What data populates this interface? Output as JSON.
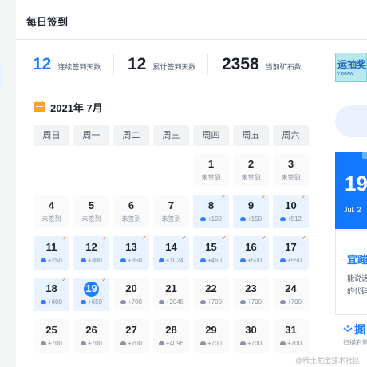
{
  "header": {
    "title": "每日签到"
  },
  "stats": [
    {
      "value": "12",
      "label": "连续签到天数",
      "color": "#1e80ff"
    },
    {
      "value": "12",
      "label": "累计签到天数",
      "color": "#1d2129"
    },
    {
      "value": "2358",
      "label": "当前矿石数",
      "color": "#1d2129"
    }
  ],
  "calendar": {
    "month_label": "2021年 7月",
    "weekdays": [
      "周日",
      "周一",
      "周二",
      "周三",
      "周四",
      "周五",
      "周六"
    ],
    "days": [
      {
        "day": "1",
        "sub": "未签到",
        "status": "unsigned"
      },
      {
        "day": "2",
        "sub": "未签到",
        "status": "unsigned"
      },
      {
        "day": "3",
        "sub": "未签到",
        "status": "unsigned"
      },
      {
        "day": "4",
        "sub": "未签到",
        "status": "unsigned"
      },
      {
        "day": "5",
        "sub": "未签到",
        "status": "unsigned"
      },
      {
        "day": "6",
        "sub": "未签到",
        "status": "unsigned"
      },
      {
        "day": "7",
        "sub": "未签到",
        "status": "unsigned"
      },
      {
        "day": "8",
        "sub": "+100",
        "status": "signed"
      },
      {
        "day": "9",
        "sub": "+150",
        "status": "signed"
      },
      {
        "day": "10",
        "sub": "+512",
        "status": "signed"
      },
      {
        "day": "11",
        "sub": "+250",
        "status": "signed"
      },
      {
        "day": "12",
        "sub": "+300",
        "status": "signed"
      },
      {
        "day": "13",
        "sub": "+350",
        "status": "signed"
      },
      {
        "day": "14",
        "sub": "+1024",
        "status": "signed"
      },
      {
        "day": "15",
        "sub": "+450",
        "status": "signed"
      },
      {
        "day": "16",
        "sub": "+500",
        "status": "signed"
      },
      {
        "day": "17",
        "sub": "+550",
        "status": "signed"
      },
      {
        "day": "18",
        "sub": "+600",
        "status": "signed"
      },
      {
        "day": "19",
        "sub": "+650",
        "status": "today"
      },
      {
        "day": "20",
        "sub": "+700",
        "status": "future"
      },
      {
        "day": "21",
        "sub": "+2048",
        "status": "future"
      },
      {
        "day": "22",
        "sub": "+700",
        "status": "future"
      },
      {
        "day": "23",
        "sub": "+700",
        "status": "future"
      },
      {
        "day": "24",
        "sub": "+700",
        "status": "future"
      },
      {
        "day": "25",
        "sub": "+700",
        "status": "future"
      },
      {
        "day": "26",
        "sub": "+700",
        "status": "future"
      },
      {
        "day": "27",
        "sub": "+700",
        "status": "future"
      },
      {
        "day": "28",
        "sub": "+4096",
        "status": "future"
      },
      {
        "day": "29",
        "sub": "+700",
        "status": "future"
      },
      {
        "day": "30",
        "sub": "+700",
        "status": "future"
      },
      {
        "day": "31",
        "sub": "+700",
        "status": "future"
      }
    ]
  },
  "sidebar": {
    "promo_title": "运抽奖",
    "promo_sub": "Y DRAW",
    "banner_number": "19",
    "banner_date": "Jul. 2",
    "card_title": "宜蹦",
    "card_text_1": "能说话",
    "card_text_2": "的代码",
    "logo_text": "掘",
    "scan_text": "扫描右侧"
  },
  "watermark": "@稀土掘金技术社区",
  "colors": {
    "accent": "#1e80ff",
    "signed_bg": "#e8f3ff",
    "check": "#f57b28",
    "calendar_icon": "#f5a524"
  }
}
